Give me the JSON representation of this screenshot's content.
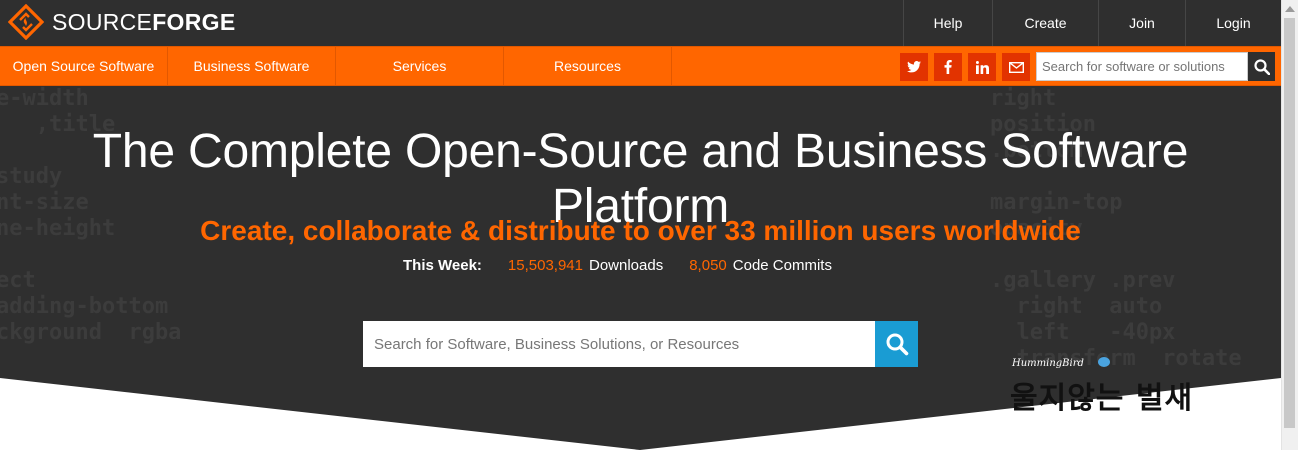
{
  "brand": {
    "name_light": "SOURCE",
    "name_bold": "FORGE"
  },
  "top_links": [
    "Help",
    "Create",
    "Join",
    "Login"
  ],
  "nav": {
    "items": [
      "Open Source Software",
      "Business Software",
      "Services",
      "Resources"
    ],
    "social_icons": [
      "twitter-icon",
      "facebook-icon",
      "linkedin-icon",
      "email-icon"
    ],
    "search_placeholder": "Search for software or solutions"
  },
  "hero": {
    "title": "The Complete Open-Source and Business Software Platform",
    "subtitle": "Create, collaborate & distribute to over 33 million users worldwide",
    "stats": {
      "label": "This Week:",
      "downloads_value": "15,503,941",
      "downloads_label": "Downloads",
      "commits_value": "8,050",
      "commits_label": "Code Commits"
    },
    "search_placeholder": "Search for Software, Business Solutions, or Resources"
  },
  "watermark": {
    "small": "HummingBird",
    "big": "울지않는 벌새"
  },
  "colors": {
    "accent": "#ff6600",
    "dark": "#2f2f2f",
    "search_button": "#1a9cd3"
  }
}
